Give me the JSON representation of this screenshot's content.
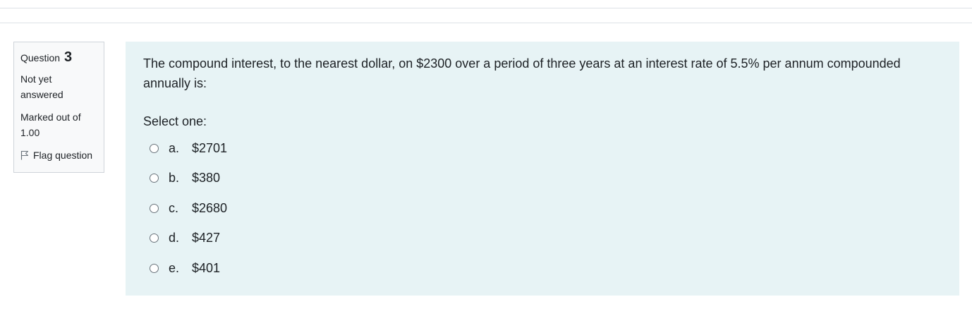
{
  "info": {
    "question_label": "Question",
    "question_number": "3",
    "state_line1": "Not yet",
    "state_line2": "answered",
    "grade_line1": "Marked out of",
    "grade_line2": "1.00",
    "flag_label": "Flag question"
  },
  "question": {
    "text": "The compound interest, to the nearest dollar, on $2300 over a period of three years at an interest rate of 5.5% per annum compounded annually is:",
    "prompt": "Select one:",
    "answers": [
      {
        "letter": "a.",
        "text": "$2701"
      },
      {
        "letter": "b.",
        "text": "$380"
      },
      {
        "letter": "c.",
        "text": "$2680"
      },
      {
        "letter": "d.",
        "text": "$427"
      },
      {
        "letter": "e.",
        "text": "$401"
      }
    ]
  },
  "colors": {
    "content_bg": "#e7f3f5",
    "info_bg": "#f8f9fa",
    "text": "#1d2125"
  },
  "icons": {
    "flag": "flag-icon",
    "radio": "radio-unchecked"
  }
}
